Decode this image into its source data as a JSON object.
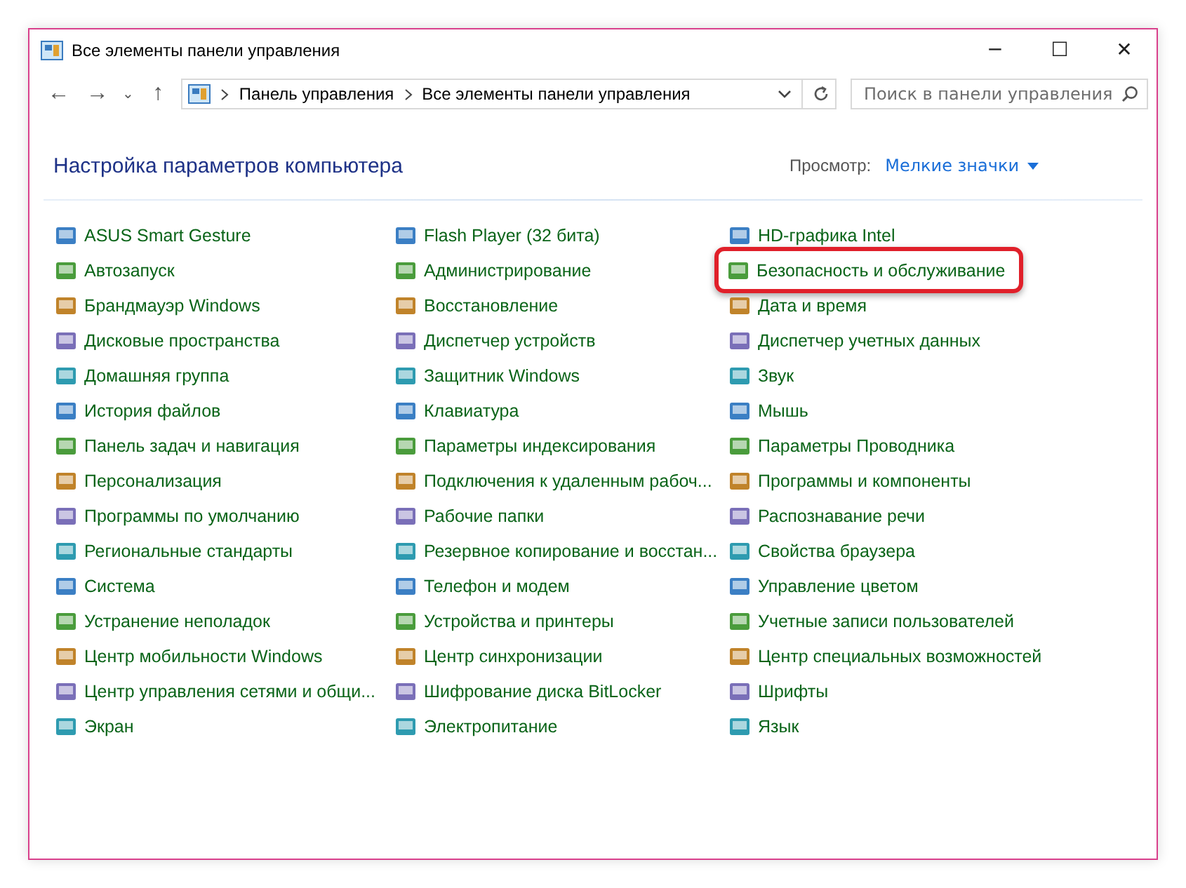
{
  "window": {
    "title": "Все элементы панели управления",
    "buttons": [
      "─",
      "☐",
      "✕"
    ]
  },
  "toolbar": {
    "nav": [
      "←",
      "→",
      "⌄",
      "↑"
    ],
    "breadcrumb": [
      "Панель управления",
      "Все элементы панели управления"
    ],
    "search": {
      "placeholder": "Поиск в панели управления"
    }
  },
  "header": {
    "title": "Настройка параметров компьютера",
    "view_label": "Просмотр:",
    "view_value": "Мелкие значки"
  },
  "columns": [
    [
      {
        "label": "ASUS Smart Gesture",
        "highlighted": false
      },
      {
        "label": "Автозапуск",
        "highlighted": false
      },
      {
        "label": "Брандмауэр Windows",
        "highlighted": false
      },
      {
        "label": "Дисковые пространства",
        "highlighted": false
      },
      {
        "label": "Домашняя группа",
        "highlighted": false
      },
      {
        "label": "История файлов",
        "highlighted": false
      },
      {
        "label": "Панель задач и навигация",
        "highlighted": false
      },
      {
        "label": "Персонализация",
        "highlighted": false
      },
      {
        "label": "Программы по умолчанию",
        "highlighted": false
      },
      {
        "label": "Региональные стандарты",
        "highlighted": false
      },
      {
        "label": "Система",
        "highlighted": false
      },
      {
        "label": "Устранение неполадок",
        "highlighted": false
      },
      {
        "label": "Центр мобильности Windows",
        "highlighted": false
      },
      {
        "label": "Центр управления сетями и общи...",
        "highlighted": false
      },
      {
        "label": "Экран",
        "highlighted": false
      }
    ],
    [
      {
        "label": "Flash Player (32 бита)",
        "highlighted": false
      },
      {
        "label": "Администрирование",
        "highlighted": false
      },
      {
        "label": "Восстановление",
        "highlighted": false
      },
      {
        "label": "Диспетчер устройств",
        "highlighted": false
      },
      {
        "label": "Защитник Windows",
        "highlighted": false
      },
      {
        "label": "Клавиатура",
        "highlighted": false
      },
      {
        "label": "Параметры индексирования",
        "highlighted": false
      },
      {
        "label": "Подключения к удаленным рабоч...",
        "highlighted": false
      },
      {
        "label": "Рабочие папки",
        "highlighted": false
      },
      {
        "label": "Резервное копирование и восстан...",
        "highlighted": false
      },
      {
        "label": "Телефон и модем",
        "highlighted": false
      },
      {
        "label": "Устройства и принтеры",
        "highlighted": false
      },
      {
        "label": "Центр синхронизации",
        "highlighted": false
      },
      {
        "label": "Шифрование диска BitLocker",
        "highlighted": false
      },
      {
        "label": "Электропитание",
        "highlighted": false
      }
    ],
    [
      {
        "label": "HD-графика Intel",
        "highlighted": false
      },
      {
        "label": "Безопасность и обслуживание",
        "highlighted": true
      },
      {
        "label": "Дата и время",
        "highlighted": false
      },
      {
        "label": "Диспетчер учетных данных",
        "highlighted": false
      },
      {
        "label": "Звук",
        "highlighted": false
      },
      {
        "label": "Мышь",
        "highlighted": false
      },
      {
        "label": "Параметры Проводника",
        "highlighted": false
      },
      {
        "label": "Программы и компоненты",
        "highlighted": false
      },
      {
        "label": "Распознавание речи",
        "highlighted": false
      },
      {
        "label": "Свойства браузера",
        "highlighted": false
      },
      {
        "label": "Управление цветом",
        "highlighted": false
      },
      {
        "label": "Учетные записи пользователей",
        "highlighted": false
      },
      {
        "label": "Центр специальных возможностей",
        "highlighted": false
      },
      {
        "label": "Шрифты",
        "highlighted": false
      },
      {
        "label": "Язык",
        "highlighted": false
      }
    ]
  ]
}
